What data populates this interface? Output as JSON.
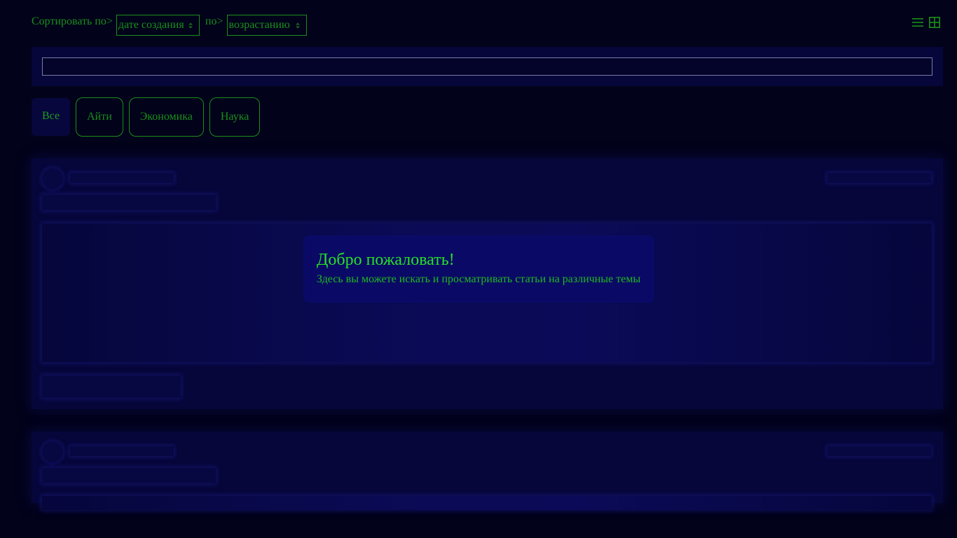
{
  "sort": {
    "label": "Сортировать по>",
    "field_value": "дате создания",
    "order_label": "по>",
    "order_value": "возрастанию"
  },
  "view_icons": [
    "list-view-icon",
    "grid-view-icon"
  ],
  "search": {
    "value": "",
    "placeholder": ""
  },
  "categories": [
    {
      "label": "Все",
      "active": true
    },
    {
      "label": "Айти",
      "active": false
    },
    {
      "label": "Экономика",
      "active": false
    },
    {
      "label": "Наука",
      "active": false
    }
  ],
  "welcome": {
    "title": "Добро пожаловать!",
    "text": "Здесь вы можете искать и просматривать статьи на различные темы"
  },
  "colors": {
    "background": "#02021a",
    "panel": "#06063a",
    "accent_green": "#1a8f1a",
    "welcome_title": "#27e027",
    "welcome_bg": "#0a0a66"
  }
}
